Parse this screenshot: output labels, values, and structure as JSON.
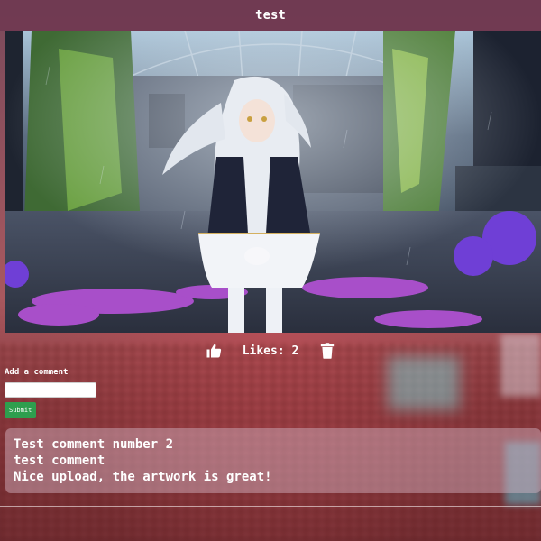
{
  "page": {
    "title": "test"
  },
  "artwork": {
    "subject": "anime character with white hair in overgrown ruined greenhouse with purple flowers"
  },
  "actions": {
    "like_icon": "thumbs-up-icon",
    "likes_text": "Likes: 2",
    "delete_icon": "trash-icon"
  },
  "comment_form": {
    "label": "Add a comment",
    "input_value": "",
    "submit_label": "Submit"
  },
  "comments": [
    "Test comment number 2",
    "test comment",
    "Nice upload, the artwork is great!"
  ],
  "colors": {
    "title_bar": "#6e3750",
    "submit_button": "#2e9e4e",
    "text": "#ffffff"
  }
}
